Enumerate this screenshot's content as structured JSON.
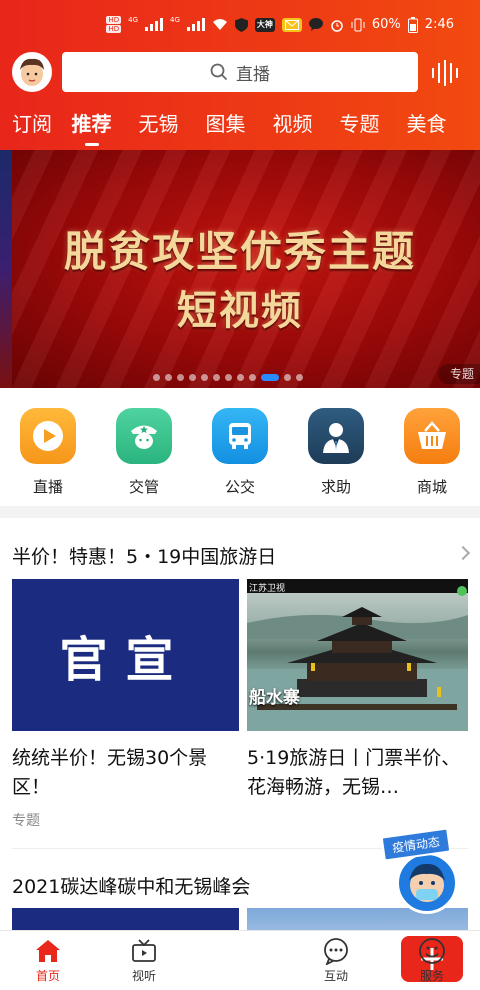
{
  "status_bar": {
    "network_top": "HD",
    "network_bottom": "HD",
    "sig1_label": "4G",
    "sig2_label": "4G",
    "app_badge_1": "大神",
    "battery": "60%",
    "time": "2:46"
  },
  "search": {
    "placeholder": "直播"
  },
  "tabs": [
    "订阅",
    "推荐",
    "无锡",
    "图集",
    "视频",
    "专题",
    "美食"
  ],
  "active_tab": "推荐",
  "banner": {
    "line1": "脱贫攻坚优秀主题",
    "line2": "短视频",
    "tag": "专题",
    "dot_count": 12,
    "active_dot": 9
  },
  "quick": [
    {
      "label": "直播",
      "icon": "play-icon",
      "color": "#f6a623"
    },
    {
      "label": "交管",
      "icon": "police-icon",
      "color": "#37c28e"
    },
    {
      "label": "公交",
      "icon": "bus-icon",
      "color": "#1e9be8"
    },
    {
      "label": "求助",
      "icon": "person-help-icon",
      "color": "#254a6a"
    },
    {
      "label": "商城",
      "icon": "basket-icon",
      "color": "#f7891e"
    }
  ],
  "section1": {
    "title": "半价！特惠！5・19中国旅游日",
    "card1_image_text": "官宣",
    "card1_caption": "统统半价！无锡30个景区！",
    "card2_watermark": "船水寨",
    "card2_logo": "江苏卫视",
    "card2_caption": "5·19旅游日丨门票半价、花海畅游，无锡…",
    "meta": "专题"
  },
  "section2": {
    "title": "2021碳达峰碳中和无锡峰会"
  },
  "floating": {
    "tag": "疫情动态"
  },
  "nav": [
    {
      "label": "首页",
      "icon": "home-icon"
    },
    {
      "label": "视听",
      "icon": "tv-icon"
    },
    {
      "label": "",
      "icon": "plus-icon"
    },
    {
      "label": "互动",
      "icon": "chat-icon"
    },
    {
      "label": "服务",
      "icon": "smile-icon"
    }
  ],
  "colors": {
    "brand": "#e8261a",
    "dot_active": "#2a8bff"
  }
}
